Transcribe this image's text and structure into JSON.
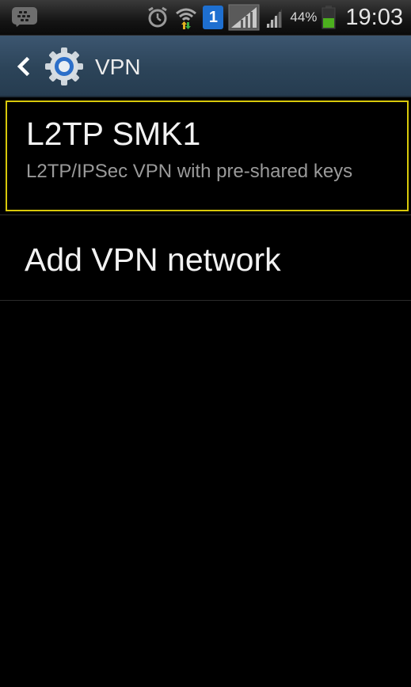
{
  "status_bar": {
    "battery_percent": "44%",
    "time": "19:03",
    "sim_slot": "1",
    "icons": [
      "bbm-icon",
      "alarm-icon",
      "wifi-icon",
      "sim-1-icon",
      "signal-icon",
      "signal-icon-2",
      "battery-icon"
    ]
  },
  "action_bar": {
    "title": "VPN",
    "back_icon": "chevron-left-icon",
    "app_icon": "settings-gear-icon"
  },
  "vpn_list": {
    "items": [
      {
        "title": "L2TP SMK1",
        "subtitle": "L2TP/IPSec VPN with pre-shared keys",
        "selected": true
      }
    ],
    "add_label": "Add VPN network"
  },
  "colors": {
    "selection_border": "#d8c80a",
    "action_bar": "#2c4459",
    "battery_green": "#4caf1e"
  }
}
